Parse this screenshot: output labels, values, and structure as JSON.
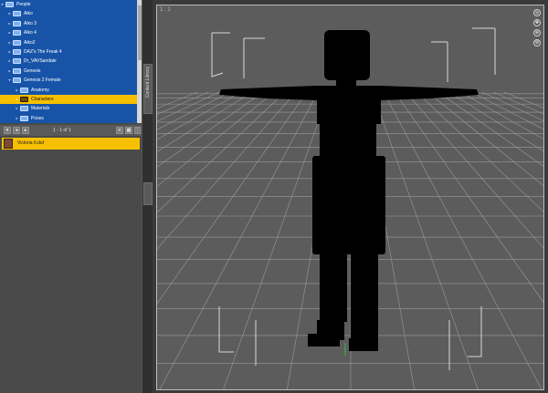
{
  "library": {
    "items": [
      {
        "label": "People",
        "depth": 0,
        "expanded": true,
        "selected": false
      },
      {
        "label": "Aiko",
        "depth": 1,
        "expanded": false,
        "selected": false
      },
      {
        "label": "Aiko 3",
        "depth": 1,
        "expanded": false,
        "selected": false
      },
      {
        "label": "Aiko 4",
        "depth": 1,
        "expanded": false,
        "selected": false
      },
      {
        "label": "Aiko2",
        "depth": 1,
        "expanded": false,
        "selected": false
      },
      {
        "label": "DAZ's The Freak 4",
        "depth": 1,
        "expanded": false,
        "selected": false
      },
      {
        "label": "Dr_VAVSandale",
        "depth": 1,
        "expanded": false,
        "selected": false
      },
      {
        "label": "Genesis",
        "depth": 1,
        "expanded": false,
        "selected": false
      },
      {
        "label": "Genesis 2 Female",
        "depth": 1,
        "expanded": true,
        "selected": false
      },
      {
        "label": "Anatomy",
        "depth": 2,
        "expanded": false,
        "selected": false
      },
      {
        "label": "Characters",
        "depth": 2,
        "expanded": false,
        "selected": true
      },
      {
        "label": "Materials",
        "depth": 2,
        "expanded": false,
        "selected": false
      },
      {
        "label": "Poses",
        "depth": 2,
        "expanded": false,
        "selected": false
      }
    ]
  },
  "pager": {
    "count": "1 - 1 of 1"
  },
  "files": [
    {
      "name": "Victoria 6.duf"
    }
  ],
  "side_tabs": [
    {
      "label": "Content Library"
    },
    {
      "label": ""
    }
  ],
  "viewport": {
    "camera_label": "1 : 1"
  },
  "colors": {
    "tree_bg": "#1754a8",
    "selection": "#f6c000",
    "viewport_bg": "#5c5c5c",
    "figure": "#000000"
  }
}
